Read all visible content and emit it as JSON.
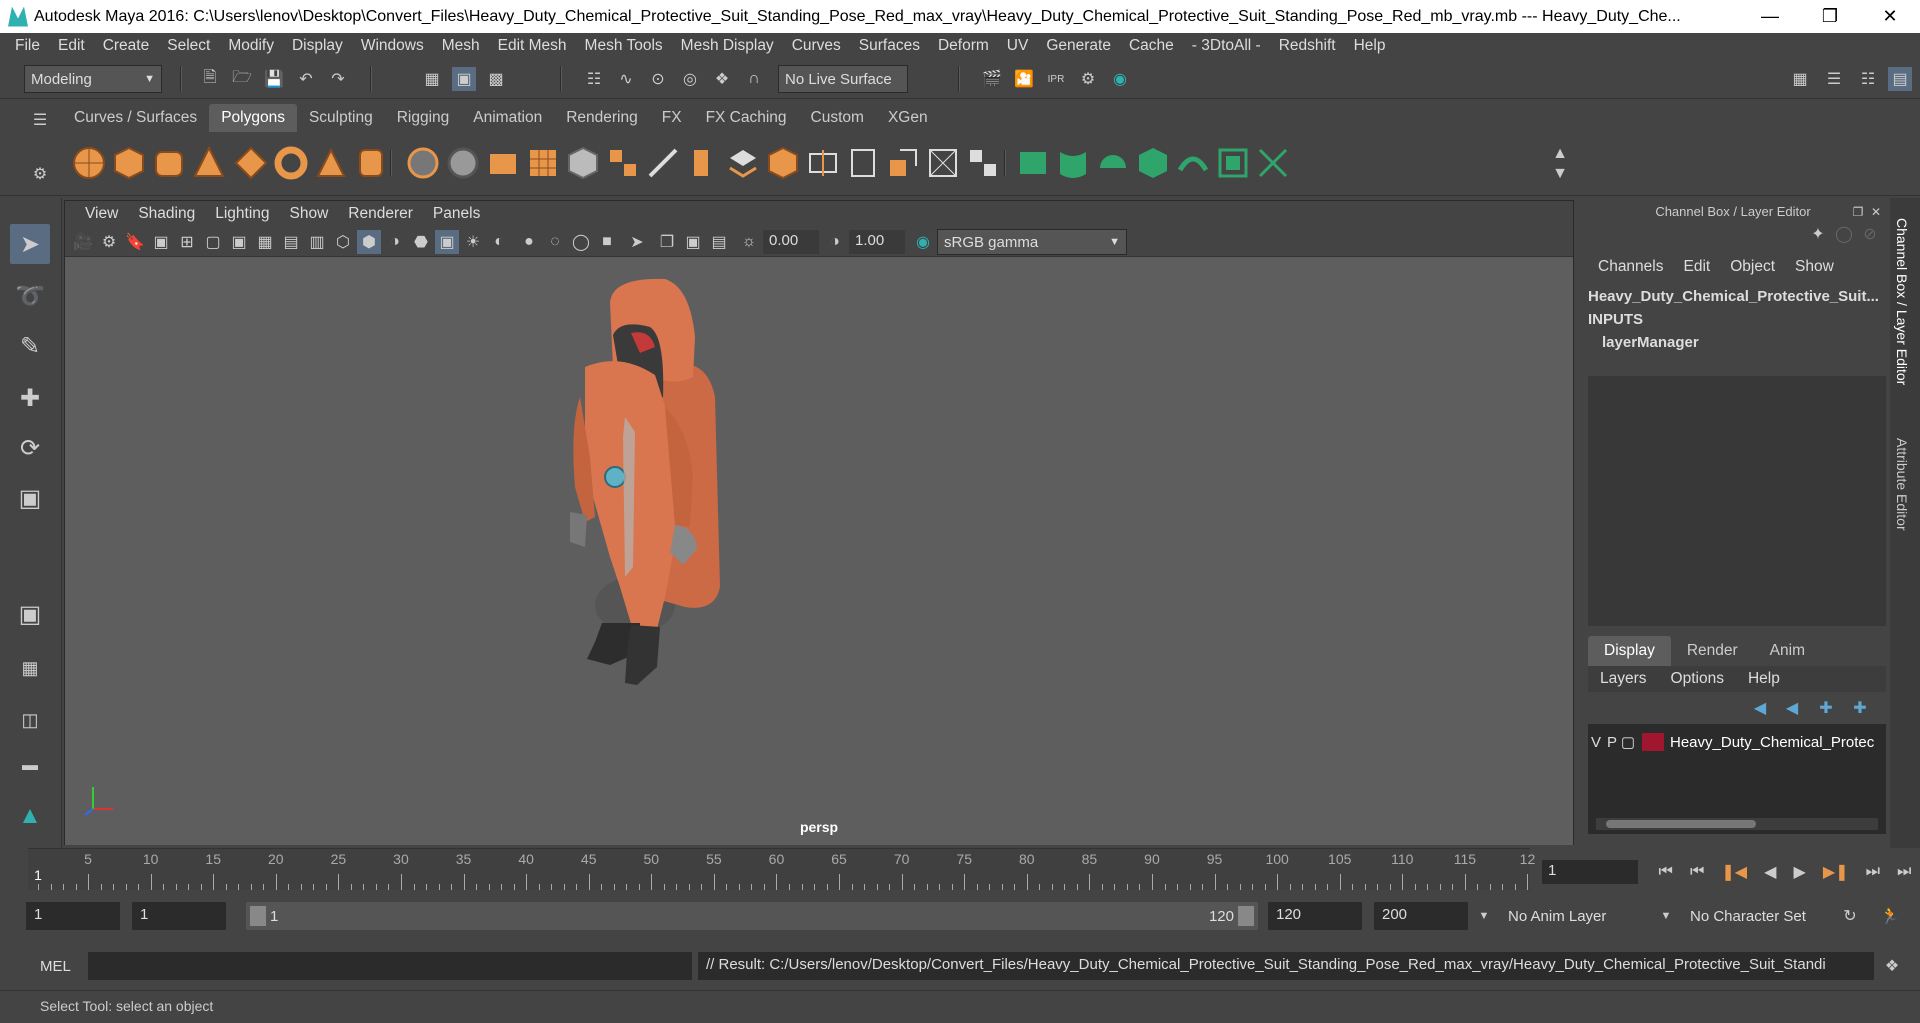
{
  "window": {
    "title": "Autodesk Maya 2016: C:\\Users\\lenov\\Desktop\\Convert_Files\\Heavy_Duty_Chemical_Protective_Suit_Standing_Pose_Red_max_vray\\Heavy_Duty_Chemical_Protective_Suit_Standing_Pose_Red_mb_vray.mb  ---  Heavy_Duty_Che..."
  },
  "menubar": [
    "File",
    "Edit",
    "Create",
    "Select",
    "Modify",
    "Display",
    "Windows",
    "Mesh",
    "Edit Mesh",
    "Mesh Tools",
    "Mesh Display",
    "Curves",
    "Surfaces",
    "Deform",
    "UV",
    "Generate",
    "Cache",
    "- 3DtoAll -",
    "Redshift",
    "Help"
  ],
  "statusline": {
    "mode": "Modeling",
    "live_surface": "No Live Surface"
  },
  "shelf": {
    "tabs": [
      "Curves / Surfaces",
      "Polygons",
      "Sculpting",
      "Rigging",
      "Animation",
      "Rendering",
      "FX",
      "FX Caching",
      "Custom",
      "XGen"
    ],
    "active": "Polygons"
  },
  "viewport": {
    "menu": [
      "View",
      "Shading",
      "Lighting",
      "Show",
      "Renderer",
      "Panels"
    ],
    "exposure": "0.00",
    "gamma": "1.00",
    "color_space": "sRGB gamma",
    "camera": "persp"
  },
  "channelbox": {
    "header": "Channel Box / Layer Editor",
    "menu": [
      "Channels",
      "Edit",
      "Object",
      "Show"
    ],
    "object": "Heavy_Duty_Chemical_Protective_Suit...",
    "inputs": "INPUTS",
    "layer_manager": "layerManager"
  },
  "layereditor": {
    "tabs": [
      "Display",
      "Render",
      "Anim"
    ],
    "active": "Display",
    "menu": [
      "Layers",
      "Options",
      "Help"
    ],
    "layer": {
      "v": "V",
      "p": "P",
      "name": "Heavy_Duty_Chemical_Protec",
      "color": "#a0162e"
    }
  },
  "sidetabs": {
    "a": "Channel Box / Layer Editor",
    "b": "Attribute Editor"
  },
  "timeline": {
    "ticks": [
      "5",
      "10",
      "15",
      "20",
      "25",
      "30",
      "35",
      "40",
      "45",
      "50",
      "55",
      "60",
      "65",
      "70",
      "75",
      "80",
      "85",
      "90",
      "95",
      "100",
      "105",
      "110",
      "115",
      "12"
    ],
    "start_marker": "1",
    "current": "1"
  },
  "range": {
    "start": "1",
    "playback_start": "1",
    "slider_start": "1",
    "slider_end": "120",
    "playback_end": "120",
    "end": "200",
    "anim_layer": "No Anim Layer",
    "char_set": "No Character Set"
  },
  "cmd": {
    "label": "MEL",
    "result": "// Result: C:/Users/lenov/Desktop/Convert_Files/Heavy_Duty_Chemical_Protective_Suit_Standing_Pose_Red_max_vray/Heavy_Duty_Chemical_Protective_Suit_Standi"
  },
  "help": "Select Tool: select an object"
}
